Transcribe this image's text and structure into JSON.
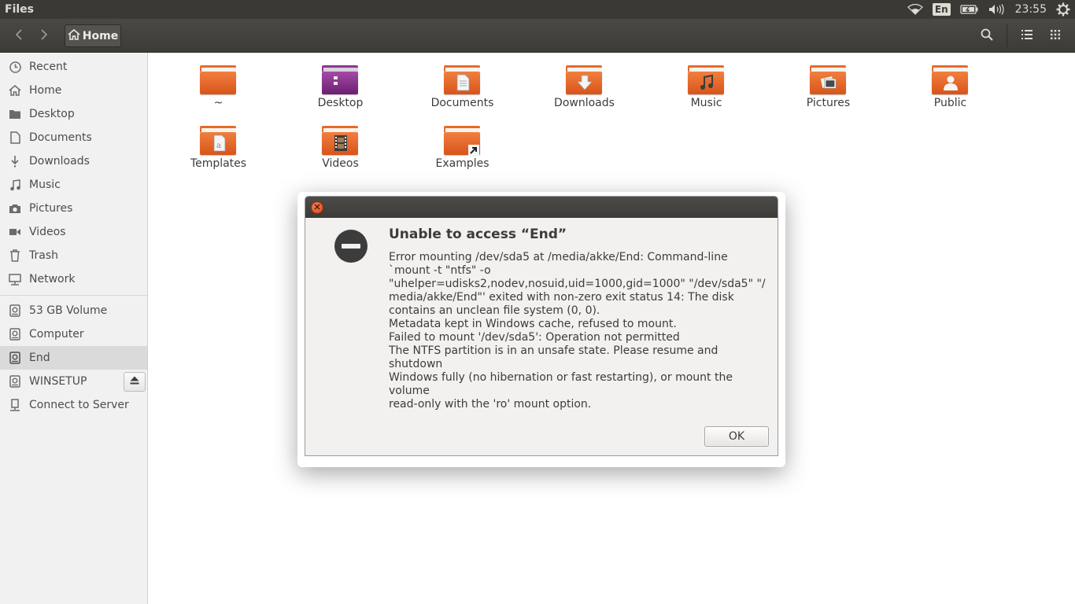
{
  "panel": {
    "app_title": "Files",
    "language": "En",
    "clock": "23:55",
    "icons": [
      "wifi-icon",
      "battery-icon",
      "volume-icon",
      "settings-gear-icon"
    ]
  },
  "header": {
    "back_icon": "chevron-left-icon",
    "forward_icon": "chevron-right-icon",
    "path_label": "Home",
    "right_icons": [
      "search-icon",
      "list-view-icon",
      "grid-view-icon"
    ]
  },
  "sidebar": {
    "places": [
      {
        "label": "Recent",
        "icon": "clock-icon"
      },
      {
        "label": "Home",
        "icon": "home-icon"
      },
      {
        "label": "Desktop",
        "icon": "folder-icon"
      },
      {
        "label": "Documents",
        "icon": "document-icon"
      },
      {
        "label": "Downloads",
        "icon": "download-icon"
      },
      {
        "label": "Music",
        "icon": "music-icon"
      },
      {
        "label": "Pictures",
        "icon": "camera-icon"
      },
      {
        "label": "Videos",
        "icon": "video-icon"
      },
      {
        "label": "Trash",
        "icon": "trash-icon"
      },
      {
        "label": "Network",
        "icon": "network-icon"
      }
    ],
    "devices": [
      {
        "label": "53 GB Volume",
        "icon": "drive-icon"
      },
      {
        "label": "Computer",
        "icon": "drive-icon"
      },
      {
        "label": "End",
        "icon": "drive-icon",
        "active": true
      },
      {
        "label": "WINSETUP",
        "icon": "drive-icon",
        "eject": true
      },
      {
        "label": "Connect to Server",
        "icon": "server-icon"
      }
    ]
  },
  "files": [
    {
      "label": "~",
      "icon": "folder-icon"
    },
    {
      "label": "Desktop",
      "icon": "desktop-folder-icon"
    },
    {
      "label": "Documents",
      "icon": "documents-folder-icon"
    },
    {
      "label": "Downloads",
      "icon": "downloads-folder-icon"
    },
    {
      "label": "Music",
      "icon": "music-folder-icon"
    },
    {
      "label": "Pictures",
      "icon": "pictures-folder-icon"
    },
    {
      "label": "Public",
      "icon": "public-folder-icon"
    },
    {
      "label": "Templates",
      "icon": "templates-folder-icon"
    },
    {
      "label": "Videos",
      "icon": "videos-folder-icon"
    },
    {
      "label": "Examples",
      "icon": "examples-folder-icon"
    }
  ],
  "dialog": {
    "title": "Unable to access “End”",
    "message": "Error mounting /dev/sda5 at /media/akke/End: Command-line\n`mount -t \"ntfs\" -o\n\"uhelper=udisks2,nodev,nosuid,uid=1000,gid=1000\" \"/dev/sda5\" \"/\nmedia/akke/End\"' exited with non-zero exit status 14: The disk\ncontains an unclean file system (0, 0).\nMetadata kept in Windows cache, refused to mount.\nFailed to mount '/dev/sda5': Operation not permitted\nThe NTFS partition is in an unsafe state. Please resume and shutdown\nWindows fully (no hibernation or fast restarting), or mount the\nvolume\nread-only with the 'ro' mount option.",
    "ok_label": "OK",
    "icon": "error-stop-icon"
  },
  "colors": {
    "panel_bg": "#3a3936",
    "folder_orange": "#e86a2a",
    "close_button": "#e5592c",
    "sidebar_active": "#dadada"
  }
}
